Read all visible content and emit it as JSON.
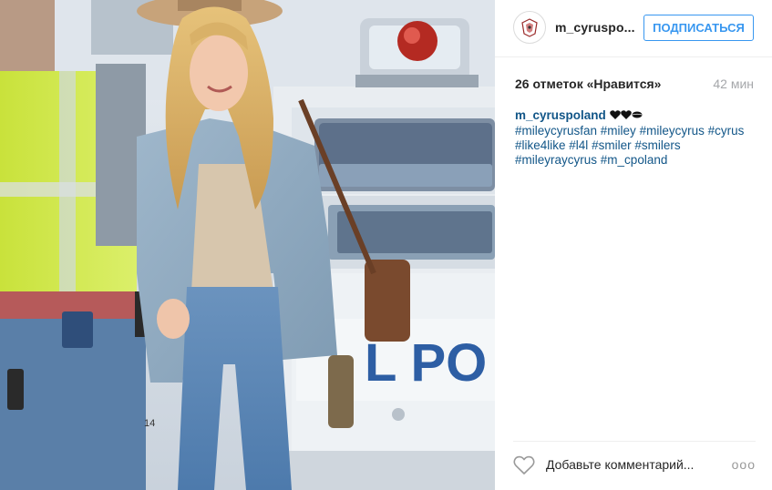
{
  "post": {
    "username": "m_cyruspo...",
    "follow_label": "ПОДПИСАТЬСЯ",
    "likes_text": "26 отметок «Нравится»",
    "time_ago": "42 мин",
    "caption": {
      "username": "m_cyruspoland",
      "emoji": "🖤❤️💋",
      "hashtags": [
        "#mileycyrusfan",
        "#miley",
        "#mileycyrus",
        "#cyrus",
        "#like4like",
        "#l4l",
        "#smiler",
        "#smilers",
        "#mileyraycyrus",
        "#m_cpoland"
      ]
    }
  },
  "comment": {
    "placeholder": "Добавьте комментарий...",
    "more_label": "ooo"
  },
  "photo": {
    "car_text": "POLICE",
    "car_text_visible": "L PO",
    "vest_number": "14"
  },
  "icons": [
    "heart-icon",
    "avatar-logo",
    "more-options-icon"
  ],
  "colors": {
    "accent": "#3897f0",
    "link": "#125688",
    "muted": "#a5a7aa"
  }
}
